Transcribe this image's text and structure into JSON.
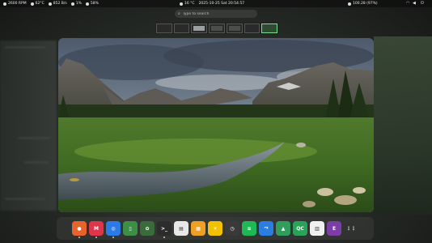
{
  "topbar": {
    "left": [
      {
        "icon": "fan-icon",
        "text": "2600 RPM"
      },
      {
        "icon": "thermometer-icon",
        "text": "62°C"
      },
      {
        "icon": "memory-icon",
        "text": "852 B/s"
      },
      {
        "icon": "cpu-icon",
        "text": "1%"
      },
      {
        "icon": "disk-icon",
        "text": "58%"
      }
    ],
    "center": [
      {
        "icon": "weather-icon",
        "text": "16 °C"
      },
      {
        "icon": "",
        "text": "2025-10-25 Sat 20:54:57"
      }
    ],
    "right": [
      {
        "icon": "battery-icon",
        "text": "100.28 (97%)"
      }
    ]
  },
  "search": {
    "placeholder": "Type to search"
  },
  "workspaces": [
    {
      "label": "Workspace 1",
      "active": false
    },
    {
      "label": "Workspace 2",
      "active": false
    },
    {
      "label": "Workspace 3",
      "active": false
    },
    {
      "label": "Workspace 4",
      "active": false
    },
    {
      "label": "Workspace 5",
      "active": false
    },
    {
      "label": "Workspace 6",
      "active": false
    },
    {
      "label": "Workspace 7",
      "active": true
    }
  ],
  "dock": [
    {
      "name": "firefox",
      "color": "#e6632b",
      "glyph": "●"
    },
    {
      "name": "mastodon",
      "color": "#e0344a",
      "glyph": "M"
    },
    {
      "name": "browser",
      "color": "#2b7be6",
      "glyph": "◎"
    },
    {
      "name": "phone",
      "color": "#3d8f45",
      "glyph": "▯"
    },
    {
      "name": "plant",
      "color": "#3a6b3a",
      "glyph": "✿"
    },
    {
      "name": "terminal",
      "color": "#2c2c2c",
      "glyph": ">_"
    },
    {
      "name": "maps",
      "color": "#e8e8e8",
      "glyph": "▤"
    },
    {
      "name": "photos",
      "color": "#f0a020",
      "glyph": "▦"
    },
    {
      "name": "weather",
      "color": "#f2c200",
      "glyph": "☀"
    },
    {
      "name": "clock",
      "color": "#3a3a3a",
      "glyph": "◷"
    },
    {
      "name": "spotify",
      "color": "#1db954",
      "glyph": "≋"
    },
    {
      "name": "share",
      "color": "#2a7ee0",
      "glyph": "⤳"
    },
    {
      "name": "inkscape",
      "color": "#2f9e5a",
      "glyph": "▲"
    },
    {
      "name": "qtcreator",
      "color": "#2aa35a",
      "glyph": "QC"
    },
    {
      "name": "libreoffice",
      "color": "#f0f0f0",
      "glyph": "▥"
    },
    {
      "name": "emacs",
      "color": "#7a3ea6",
      "glyph": "E"
    },
    {
      "name": "app-grid",
      "color": "transparent",
      "glyph": "⋮⋮"
    }
  ]
}
